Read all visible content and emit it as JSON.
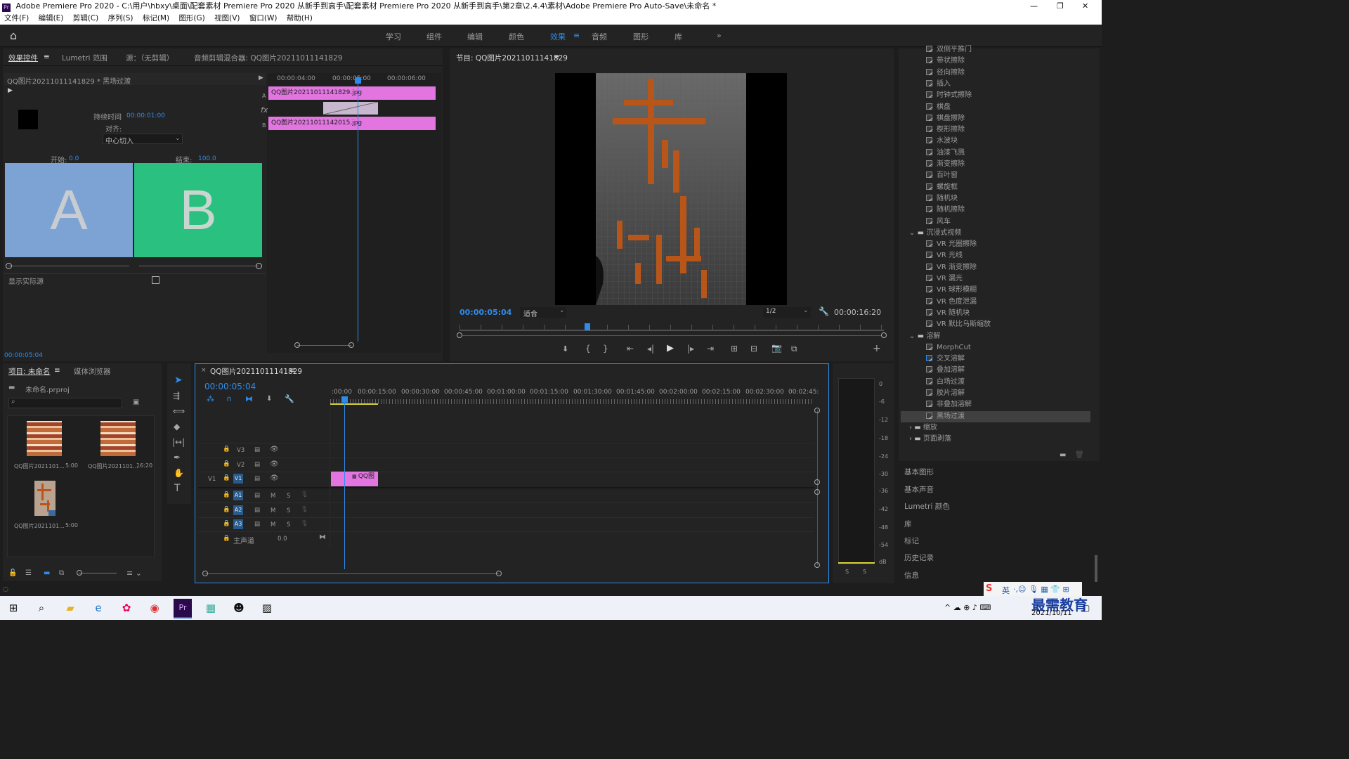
{
  "window": {
    "title": "Adobe Premiere Pro 2020 - C:\\用户\\hbxy\\桌面\\配套素材 Premiere Pro 2020 从新手到高手\\配套素材 Premiere Pro 2020 从新手到高手\\第2章\\2.4.4\\素材\\Adobe Premiere Pro Auto-Save\\未命名 *",
    "app_icon": "Pr"
  },
  "menu": [
    "文件(F)",
    "编辑(E)",
    "剪辑(C)",
    "序列(S)",
    "标记(M)",
    "图形(G)",
    "视图(V)",
    "窗口(W)",
    "帮助(H)"
  ],
  "workspaces": [
    "学习",
    "组件",
    "编辑",
    "颜色",
    "效果",
    "音频",
    "图形",
    "库"
  ],
  "active_workspace": "效果",
  "effect_controls": {
    "tabs": [
      "效果控件",
      "Lumetri 范围",
      "源：（无剪辑）",
      "音频剪辑混合器: QQ图片20211011141829"
    ],
    "clip_label": "QQ图片20211011141829 * 黑场过渡",
    "duration_label": "持续时间",
    "duration_value": "00:00:01:00",
    "align_label": "对齐:",
    "align_value": "中心切入",
    "start_label": "开始:",
    "start_value": "0.0",
    "end_label": "结束:",
    "end_value": "100.0",
    "preview_a": "A",
    "preview_b": "B",
    "show_source_label": "显示实际源",
    "timecode": "00:00:05:04",
    "mini_ruler": [
      "00:00:04:00",
      "00:00:05:00",
      "00:00:06:00"
    ],
    "clip_a": "QQ图片20211011141829.jpg",
    "clip_b": "QQ图片20211011142015.jpg",
    "track_a": "A",
    "track_b": "B",
    "fx": "fx"
  },
  "program": {
    "title": "节目: QQ图片20211011141829",
    "timecode": "00:00:05:04",
    "fit": "适合",
    "resolution": "1/2",
    "duration": "00:00:16:20"
  },
  "project": {
    "tabs": [
      "项目: 未命名",
      "媒体浏览器"
    ],
    "file": "未命名.prproj",
    "items": [
      {
        "name": "QQ图片2021101...",
        "dur": "5:00"
      },
      {
        "name": "QQ图片2021101...",
        "dur": "16:20"
      },
      {
        "name": "QQ图片2021101...",
        "dur": "5:00"
      }
    ]
  },
  "timeline": {
    "tab": "QQ图片20211011141829",
    "timecode": "00:00:05:04",
    "ruler": [
      ":00:00",
      "00:00:15:00",
      "00:00:30:00",
      "00:00:45:00",
      "00:01:00:00",
      "00:01:15:00",
      "00:01:30:00",
      "00:01:45:00",
      "00:02:00:00",
      "00:02:15:00",
      "00:02:30:00",
      "00:02:45:"
    ],
    "video_tracks": [
      "V3",
      "V2",
      "V1"
    ],
    "audio_tracks": [
      "A1",
      "A2",
      "A3"
    ],
    "v1_source": "V1",
    "master_label": "主声道",
    "master_value": "0.0",
    "clip_label": "QQ图",
    "mute": "M",
    "solo": "S"
  },
  "meter": {
    "scale": [
      "0",
      "-6",
      "-12",
      "-18",
      "-24",
      "-30",
      "-36",
      "-42",
      "-48",
      "-54",
      "dB"
    ],
    "solo_left": "S",
    "solo_right": "S"
  },
  "effects": {
    "items_top": [
      "双侧平推门",
      "带状擦除",
      "径向擦除",
      "插入",
      "时钟式擦除",
      "棋盘",
      "棋盘擦除",
      "楔形擦除",
      "水波块",
      "油漆飞溅",
      "渐变擦除",
      "百叶窗",
      "螺旋框",
      "随机块",
      "随机擦除",
      "风车"
    ],
    "folder_vr": "沉浸式视频",
    "items_vr": [
      "VR 光圈擦除",
      "VR 光线",
      "VR 渐变擦除",
      "VR 漏光",
      "VR 球形模糊",
      "VR 色度泄漏",
      "VR 随机块",
      "VR 默比乌斯缩放"
    ],
    "folder_dissolve": "溶解",
    "items_dissolve": [
      "MorphCut",
      "交叉溶解",
      "叠加溶解",
      "白场过渡",
      "胶片溶解",
      "非叠加溶解",
      "黑场过渡"
    ],
    "selected": "黑场过渡",
    "folder_zoom": "缩放",
    "folder_page": "页面剥落"
  },
  "side_panels": [
    "基本图形",
    "基本声音",
    "Lumetri 颜色",
    "库",
    "标记",
    "历史记录",
    "信息"
  ],
  "taskbar": {
    "date": "2021/10/11",
    "watermark": "最需教育",
    "ime": "英"
  },
  "accent": "#2d8ceb",
  "clip_color": "#e275e0",
  "selected_row": "#404040"
}
